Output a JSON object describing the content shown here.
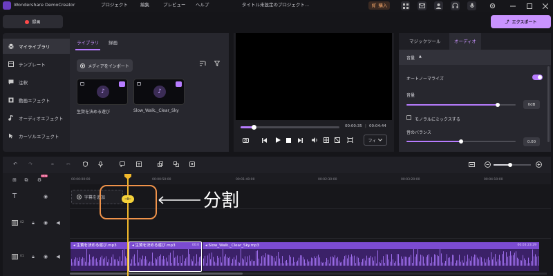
{
  "app": {
    "title": "Wondershare DemoCreator",
    "menus": [
      "プロジェクト",
      "編集",
      "プレビュー",
      "ヘルプ"
    ],
    "doc_title": "タイトル未設定のプロジェクト...",
    "buy_label": "購入"
  },
  "toolbar": {
    "record_label": "録画",
    "export_label": "エクスポート"
  },
  "nav": {
    "items": [
      {
        "label": "マイライブラリ",
        "icon": "layers-icon"
      },
      {
        "label": "テンプレート",
        "icon": "template-icon"
      },
      {
        "label": "注釈",
        "icon": "annotation-icon"
      },
      {
        "label": "動画エフェクト",
        "icon": "film-icon"
      },
      {
        "label": "オーディオエフェクト",
        "icon": "music-note-icon"
      },
      {
        "label": "カーソルエフェクト",
        "icon": "cursor-icon"
      }
    ]
  },
  "library": {
    "tabs": [
      "ライブラリ",
      "録画"
    ],
    "import_label": "メディアをインポート",
    "items": [
      {
        "name": "生贄を決める遊び"
      },
      {
        "name": "Slow_Walk,_Clear_Sky"
      }
    ]
  },
  "preview": {
    "current_time": "00:00:35",
    "total_time": "00:04:44",
    "zoom_label": "フィ",
    "progress": 0.12
  },
  "panel": {
    "tabs": [
      "マジックツール",
      "オーディオ"
    ],
    "section": "音量",
    "auto_normalize_label": "オートノーマライズ",
    "volume_label": "音量",
    "volume_value": "0dB",
    "mono_label": "モノラルにミックスする",
    "balance_label": "音のバランス",
    "balance_value": "0.00"
  },
  "timeline": {
    "ruler": [
      "00:00:00:00",
      "00:00:50:00",
      "00:01:40:00",
      "00:02:30:00",
      "00:03:20:00",
      "00:04:10:00"
    ],
    "add_subtitle_label": "字幕を追加",
    "split_label": "分割",
    "split_annotation": "分割",
    "new_badge": "NEW",
    "tracks": [
      {
        "index": "02"
      },
      {
        "index": "01"
      }
    ],
    "clips": [
      {
        "label": "生贄を決める遊び.mp3",
        "duration": ""
      },
      {
        "label": "生贄を決める遊び.mp3",
        "duration": "00:0"
      },
      {
        "label": "Slow_Walk,_Clear_Sky.mp3",
        "duration": "00:03:23:29"
      }
    ]
  },
  "colors": {
    "accent": "#b77cff",
    "playhead": "#f2b92b",
    "highlight": "#f0934a",
    "export": "#c993ff"
  }
}
